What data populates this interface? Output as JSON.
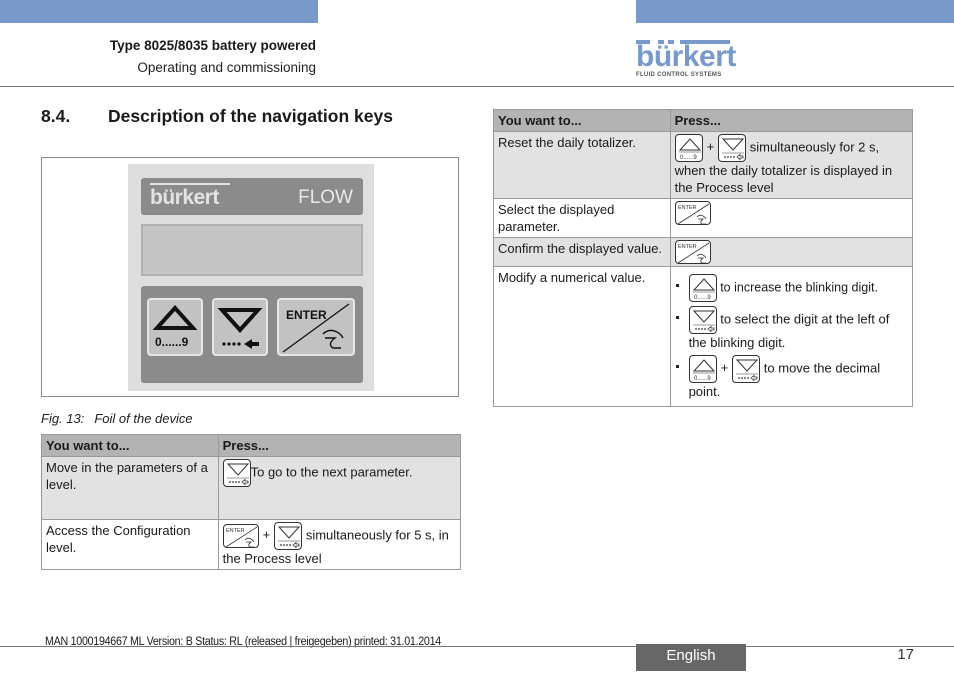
{
  "header": {
    "title": "Type 8025/8035 battery powered",
    "subtitle": "Operating and commissioning",
    "logo": {
      "word": "bürkert",
      "tagline": "FLUID CONTROL SYSTEMS"
    },
    "accent_color": "#7899c9"
  },
  "section": {
    "number": "8.4.",
    "title": "Description of the navigation keys"
  },
  "figure": {
    "device": {
      "brand": "bürkert",
      "label": "FLOW",
      "keys": [
        {
          "icon": "arrow-up-icon",
          "caption": "0......9"
        },
        {
          "icon": "arrow-down-icon",
          "caption": "····←"
        },
        {
          "icon": "enter-hand-icon",
          "caption": "ENTER"
        }
      ]
    },
    "caption_label": "Fig. 13:",
    "caption_text": "Foil of the device"
  },
  "table_left": {
    "headers": [
      "You want to...",
      "Press..."
    ],
    "rows": [
      {
        "action": "Move in the parameters of a level.",
        "keys": [
          "down"
        ],
        "text": "To go to the next parameter."
      },
      {
        "action": "Access the Configuration level.",
        "keys": [
          "enter",
          "down"
        ],
        "plus": "+",
        "text": "simultaneously for 5 s, in the Process level"
      }
    ]
  },
  "table_right": {
    "headers": [
      "You want to...",
      "Press..."
    ],
    "rows": [
      {
        "action": "Reset the daily totalizer.",
        "keys": [
          "up",
          "down"
        ],
        "plus": "+",
        "text": "simultaneously for 2 s, when the daily totalizer is displayed in the Process level"
      },
      {
        "action": "Select the displayed parameter.",
        "keys": [
          "enter"
        ]
      },
      {
        "action": "Confirm the displayed value.",
        "keys": [
          "enter"
        ]
      },
      {
        "action": "Modify a numerical value.",
        "bullets": [
          {
            "keys": [
              "up"
            ],
            "text": "to increase the blinking digit."
          },
          {
            "keys": [
              "down"
            ],
            "text": "to select the digit at the left of the blinking digit."
          },
          {
            "keys": [
              "up",
              "down"
            ],
            "plus": "+",
            "text": "to move the decimal point."
          }
        ]
      }
    ]
  },
  "key_glyphs": {
    "up_caption": "0......9",
    "enter_caption": "ENTER"
  },
  "footer": {
    "note": "MAN  1000194667  ML  Version: B Status: RL (released | freigegeben)  printed: 31.01.2014",
    "language": "English",
    "page": "17"
  }
}
